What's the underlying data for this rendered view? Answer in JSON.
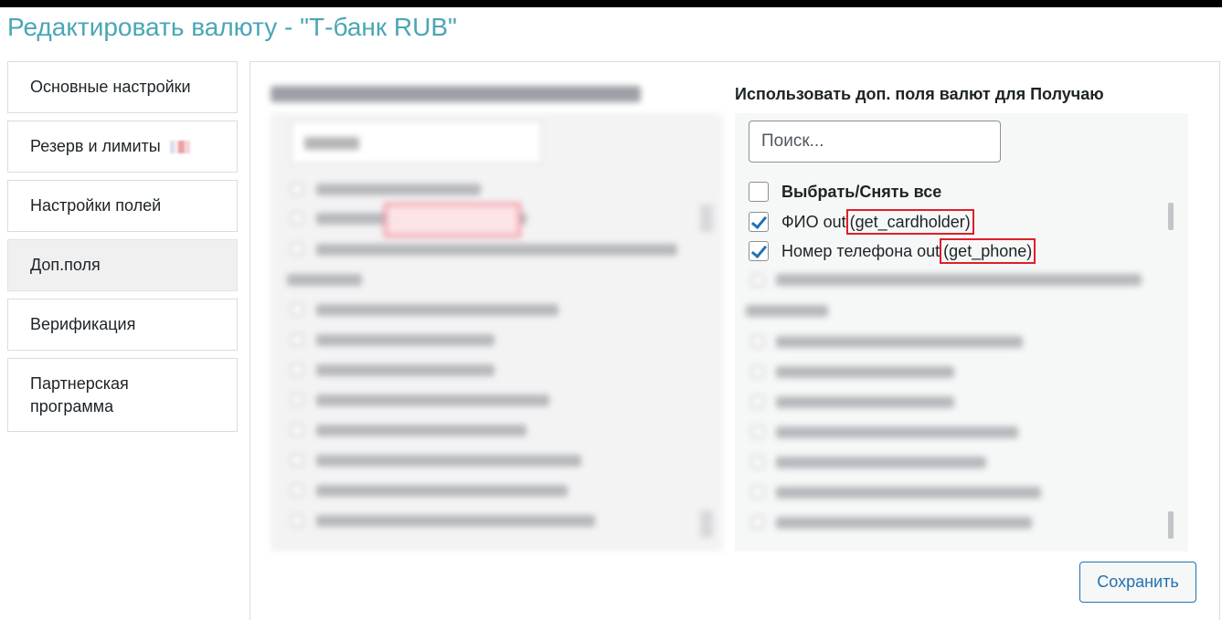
{
  "page": {
    "title": "Редактировать валюту - \"Т-банк RUB\""
  },
  "tabs": [
    {
      "label": "Основные настройки"
    },
    {
      "label": "Резерв и лимиты"
    },
    {
      "label": "Настройки полей"
    },
    {
      "label": "Доп.поля",
      "active": true
    },
    {
      "label": "Верификация"
    },
    {
      "label": "Партнерская",
      "label2": "программа"
    }
  ],
  "receive_panel": {
    "title": "Использовать доп. поля валют для Получаю",
    "search_placeholder": "Поиск...",
    "select_all_label": "Выбрать/Снять все",
    "items": [
      {
        "label": "ФИО out ",
        "code": "(get_cardholder)",
        "checked": true
      },
      {
        "label": "Номер телефона out ",
        "code": "(get_phone)",
        "checked": true
      }
    ]
  },
  "save_button": {
    "label": "Сохранить"
  },
  "colors": {
    "title": "#4aa6b5",
    "accent": "#2271b1",
    "highlight_border": "#e01e28"
  }
}
